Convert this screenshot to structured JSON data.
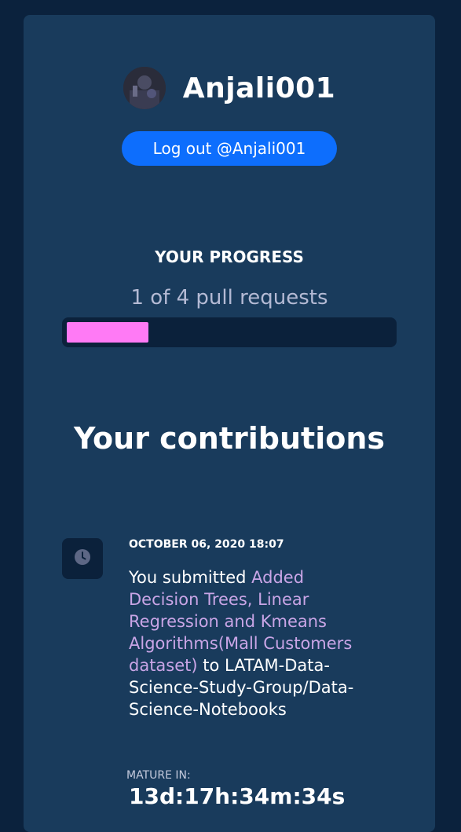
{
  "profile": {
    "username": "Anjali001",
    "logout_label": "Log out @Anjali001"
  },
  "progress": {
    "heading": "YOUR PROGRESS",
    "text": "1 of 4 pull requests",
    "completed": 1,
    "total": 4,
    "bar_color": "#ff7af5"
  },
  "contributions": {
    "heading": "Your contributions",
    "items": [
      {
        "icon": "clock-icon",
        "date": "OCTOBER 06, 2020 18:07",
        "prefix": "You submitted ",
        "pr_title": "Added Decision Trees, Linear Regression and Kmeans Algorithms(Mall Customers dataset)",
        "connector": " to",
        "repo": "LATAM-Data-Science-Study-Group/Data-Science-Notebooks",
        "mature_label": "MATURE IN:",
        "mature_value": "13d:17h:34m:34s"
      }
    ]
  },
  "colors": {
    "background": "#0b223d",
    "card": "#193b5c",
    "button": "#0d6efd",
    "link": "#c9a5e6"
  }
}
